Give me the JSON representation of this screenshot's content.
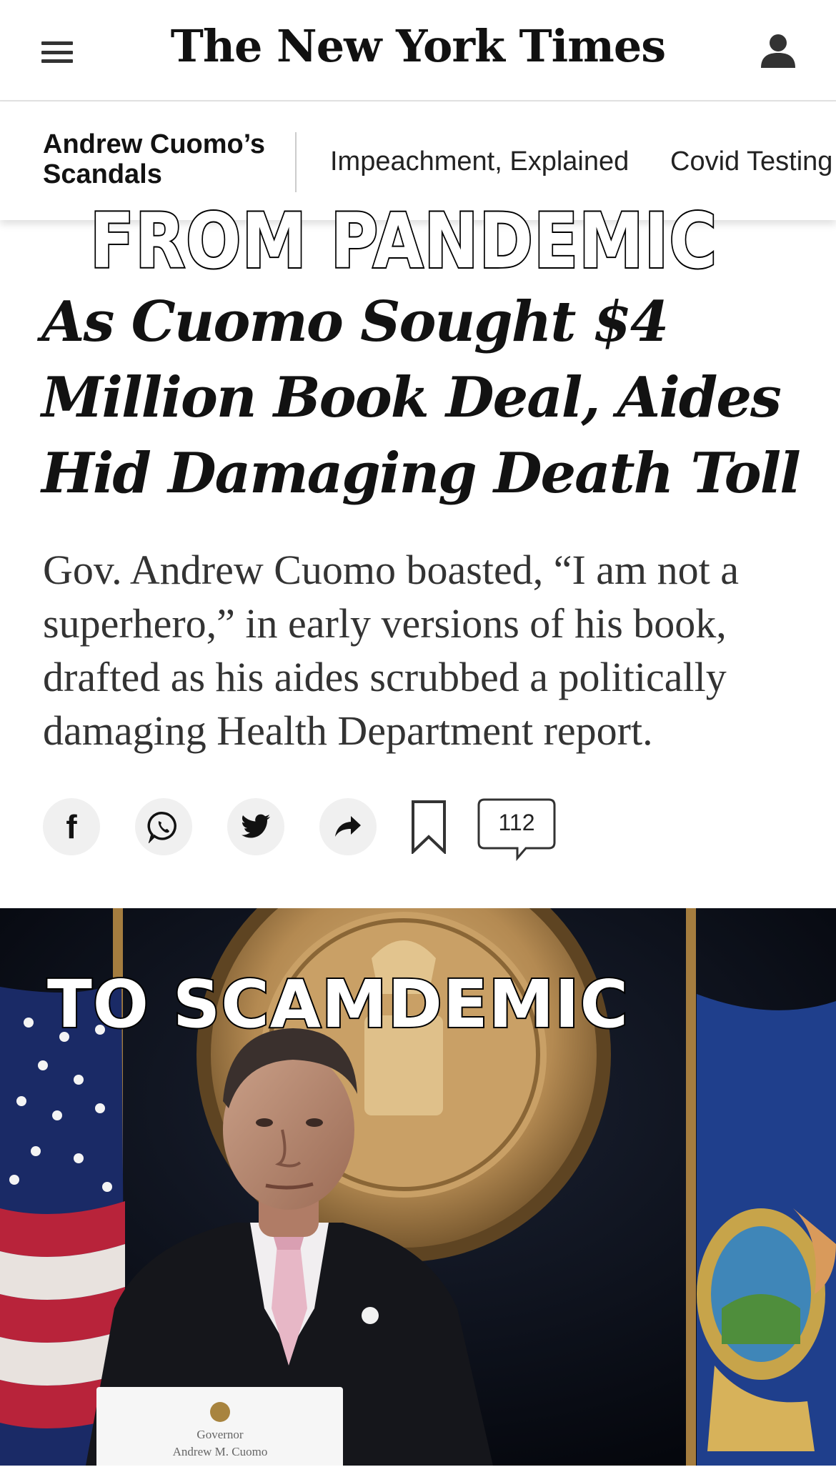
{
  "header": {
    "logo": "The New York Times",
    "menu_icon": "hamburger-menu-icon",
    "account_icon": "user-icon"
  },
  "section_nav": {
    "title": "Andrew Cuomo’s Scandals",
    "links": [
      "Impeachment, Explained",
      "Covid Testing"
    ]
  },
  "meme": {
    "top_text": "FROM PANDEMIC",
    "bottom_text": "TO SCAMDEMIC"
  },
  "article": {
    "headline": "As Cuomo Sought $4 Million Book Deal, Aides Hid Damaging Death Toll",
    "summary": "Gov. Andrew Cuomo boasted, “I am not a superhero,” in early versions of his book, drafted as his aides scrubbed a politically damaging Health Department report."
  },
  "share_bar": {
    "facebook_icon": "facebook-icon",
    "whatsapp_icon": "whatsapp-icon",
    "twitter_icon": "twitter-icon",
    "share_icon": "share-arrow-icon",
    "bookmark_icon": "bookmark-icon",
    "comment_count": "112"
  },
  "photo": {
    "nameplate_line1": "Governor",
    "nameplate_line2": "Andrew M. Cuomo"
  },
  "colors": {
    "text": "#121212",
    "button_bg": "#f0f0f0",
    "photo_background": "#0b0e1a",
    "seal_gold": "#b8925a",
    "flag_blue": "#1f3f8c"
  }
}
